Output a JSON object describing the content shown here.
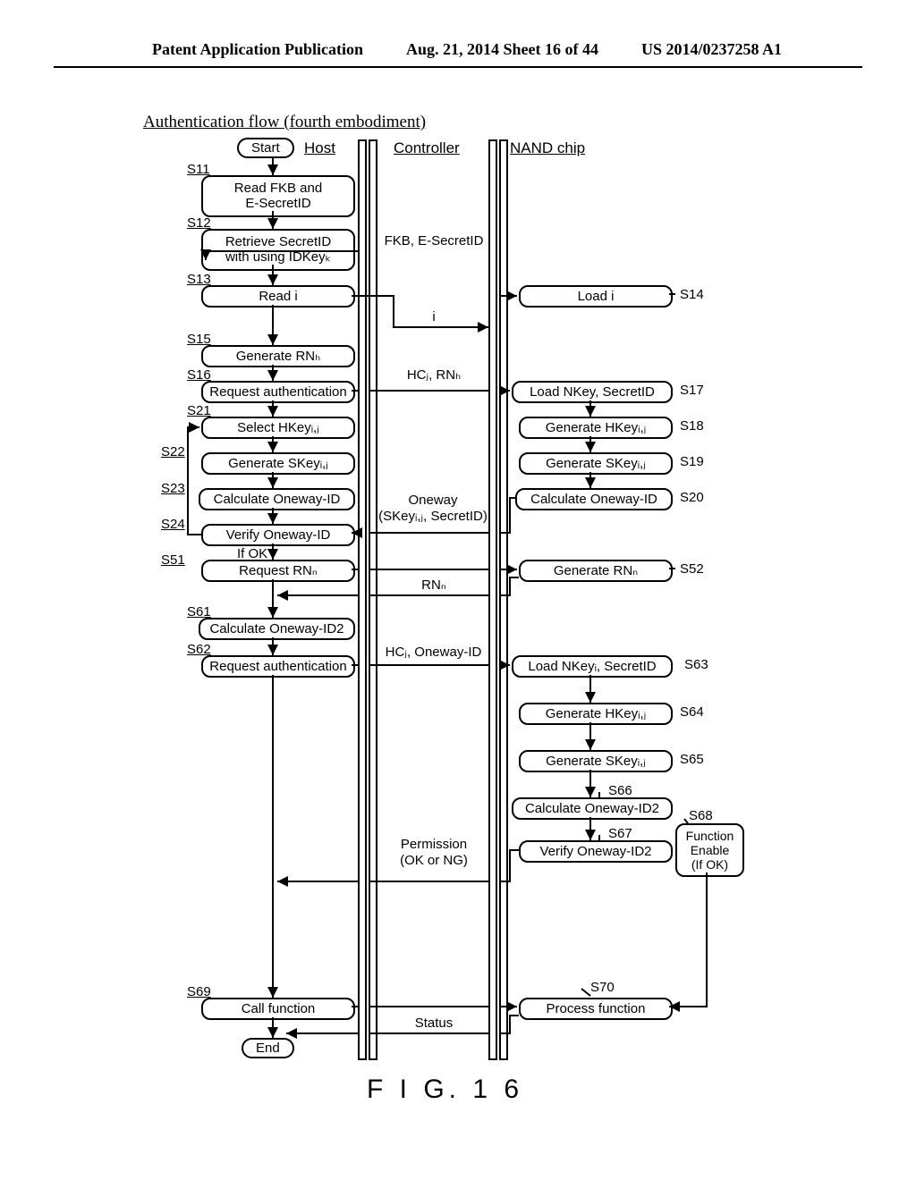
{
  "header": {
    "left": "Patent Application Publication",
    "center": "Aug. 21, 2014  Sheet 16 of 44",
    "right": "US 2014/0237258 A1"
  },
  "diagram": {
    "title": "Authentication flow (fourth embodiment)",
    "columns": {
      "host": "Host",
      "controller": "Controller",
      "nand": "NAND chip"
    },
    "terminators": {
      "start": "Start",
      "end": "End"
    },
    "steps": {
      "s11": {
        "id": "S11",
        "text": "Read FKB and\nE-SecretID"
      },
      "s12": {
        "id": "S12",
        "text": "Retrieve SecretID\nwith using IDKeyₖ"
      },
      "s13": {
        "id": "S13",
        "text": "Read i"
      },
      "s14": {
        "id": "S14",
        "text": "Load i"
      },
      "s15": {
        "id": "S15",
        "text": "Generate RNₕ"
      },
      "s16": {
        "id": "S16",
        "text": "Request authentication"
      },
      "s17": {
        "id": "S17",
        "text": "Load NKey, SecretID"
      },
      "s18": {
        "id": "S18",
        "text": "Generate HKeyᵢ,ⱼ"
      },
      "s19": {
        "id": "S19",
        "text": "Generate SKeyᵢ,ⱼ"
      },
      "s20": {
        "id": "S20",
        "text": "Calculate Oneway-ID"
      },
      "s21": {
        "id": "S21",
        "text": "Select HKeyᵢ,ⱼ"
      },
      "s22": {
        "id": "S22",
        "text": "Generate SKeyᵢ,ⱼ"
      },
      "s23": {
        "id": "S23",
        "text": "Calculate Oneway-ID"
      },
      "s24": {
        "id": "S24",
        "text": "Verify Oneway-ID"
      },
      "ifok": "If OK",
      "s51": {
        "id": "S51",
        "text": "Request RNₙ"
      },
      "s52": {
        "id": "S52",
        "text": "Generate RNₙ"
      },
      "s61": {
        "id": "S61",
        "text": "Calculate Oneway-ID2"
      },
      "s62": {
        "id": "S62",
        "text": "Request authentication"
      },
      "s63": {
        "id": "S63",
        "text": "Load NKeyᵢ, SecretID"
      },
      "s64": {
        "id": "S64",
        "text": "Generate HKeyᵢ,ⱼ"
      },
      "s65": {
        "id": "S65",
        "text": "Generate SKeyᵢ,ⱼ"
      },
      "s66": {
        "id": "S66",
        "text": "Calculate Oneway-ID2"
      },
      "s67": {
        "id": "S67",
        "text": "Verify Oneway-ID2"
      },
      "s68": {
        "id": "S68",
        "text": "Function\nEnable\n(If OK)"
      },
      "s69": {
        "id": "S69",
        "text": "Call function"
      },
      "s70": {
        "id": "S70",
        "text": "Process function"
      }
    },
    "messages": {
      "m1": "FKB, E-SecretID",
      "m2": "i",
      "m3": "HCⱼ, RNₕ",
      "m4": "Oneway\n(SKeyᵢ,ⱼ, SecretID)",
      "m5": "RNₙ",
      "m6": "HCⱼ, Oneway-ID",
      "m7": "Permission\n(OK or NG)",
      "m8": "Status"
    },
    "figure": "F I G. 1 6"
  }
}
